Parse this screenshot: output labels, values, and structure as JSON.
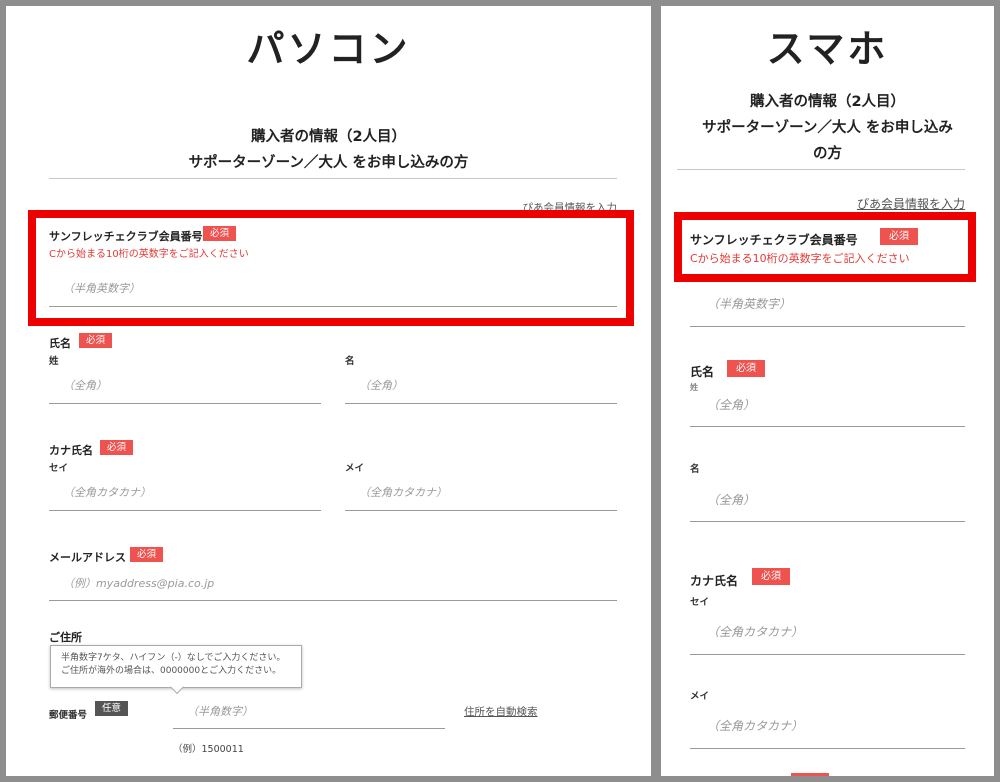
{
  "pc": {
    "title": "パソコン",
    "section_title_1": "購入者の情報（2人目）",
    "section_title_2": "サポーターゾーン／大人 をお申し込みの方",
    "pia_link": "ぴあ会員情報を入力",
    "member_label": "サンフレッチェクラブ会員番号",
    "required": "必須",
    "optional": "任意",
    "member_error": "Cから始まる10桁の英数字をご記入ください",
    "member_placeholder": "（半角英数字）",
    "name_label": "氏名",
    "sei_label": "姓",
    "mei_label": "名",
    "zenkaku_placeholder": "（全角）",
    "kana_label": "カナ氏名",
    "kana_sei_label": "セイ",
    "kana_mei_label": "メイ",
    "kana_placeholder": "（全角カタカナ）",
    "email_label": "メールアドレス",
    "email_placeholder": "（例）myaddress@pia.co.jp",
    "address_label": "ご住所",
    "tooltip_line1": "半角数字7ケタ、ハイフン（-）なしでご入力ください。",
    "tooltip_line2": "ご住所が海外の場合は、0000000とご入力ください。",
    "postal_label": "郵便番号",
    "postal_placeholder": "（半角数字）",
    "postal_search_link": "住所を自動検索",
    "postal_example": "（例）1500011"
  },
  "sp": {
    "title": "スマホ",
    "section_title_1": "購入者の情報（2人目）",
    "section_title_2a": "サポーターゾーン／大人 をお申し込み",
    "section_title_2b": "の方",
    "pia_link": "ぴあ会員情報を入力",
    "member_label": "サンフレッチェクラブ会員番号",
    "required": "必須",
    "member_error": "Cから始まる10桁の英数字をご記入ください",
    "member_placeholder": "（半角英数字）",
    "name_label": "氏名",
    "sei_label": "姓",
    "sei_placeholder": "（全角）",
    "mei_label": "名",
    "mei_placeholder": "（全角）",
    "kana_label": "カナ氏名",
    "kana_sei_label": "セイ",
    "kana_sei_placeholder": "（全角カタカナ）",
    "kana_mei_label": "メイ",
    "kana_mei_placeholder": "（全角カタカナ）"
  },
  "colors": {
    "highlight": "#ee0000",
    "required_badge": "#ef5350",
    "optional_badge": "#555555",
    "error_text": "#e53935"
  }
}
